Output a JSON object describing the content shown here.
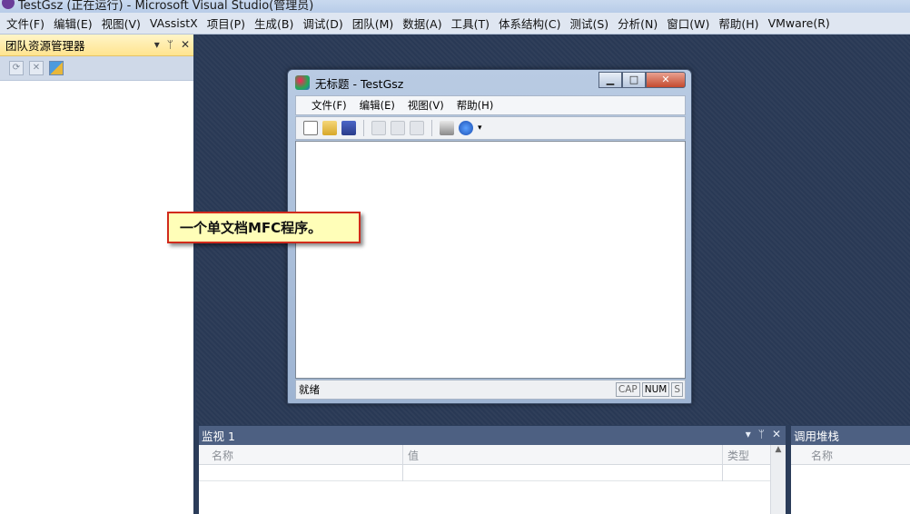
{
  "ide": {
    "title": "TestGsz (正在运行) - Microsoft Visual Studio(管理员)",
    "menu": [
      "文件(F)",
      "编辑(E)",
      "视图(V)",
      "VAssistX",
      "项目(P)",
      "生成(B)",
      "调试(D)",
      "团队(M)",
      "数据(A)",
      "工具(T)",
      "体系结构(C)",
      "测试(S)",
      "分析(N)",
      "窗口(W)",
      "帮助(H)",
      "VMware(R)"
    ]
  },
  "team_explorer": {
    "title": "团队资源管理器",
    "header_buttons": [
      "▾",
      "📌",
      "✕"
    ],
    "toolbar_icons": [
      "refresh-icon",
      "stop-icon",
      "team-project-icon"
    ]
  },
  "mfc_window": {
    "title": "无标题 - TestGsz",
    "controls": [
      "minimize",
      "maximize",
      "close"
    ],
    "menu": [
      "文件(F)",
      "编辑(E)",
      "视图(V)",
      "帮助(H)"
    ],
    "toolbar_icons": [
      "new-icon",
      "open-icon",
      "save-icon",
      "cut-icon",
      "copy-icon",
      "paste-icon",
      "print-icon",
      "help-icon"
    ],
    "status": {
      "text": "就绪",
      "cap": "CAP",
      "num": "NUM",
      "scrl": "S"
    }
  },
  "callout": {
    "text": "一个单文档MFC程序。"
  },
  "watch": {
    "title": "监视 1",
    "columns": [
      "名称",
      "值",
      "类型"
    ]
  },
  "callstack": {
    "title": "调用堆栈",
    "columns": [
      "名称"
    ]
  }
}
